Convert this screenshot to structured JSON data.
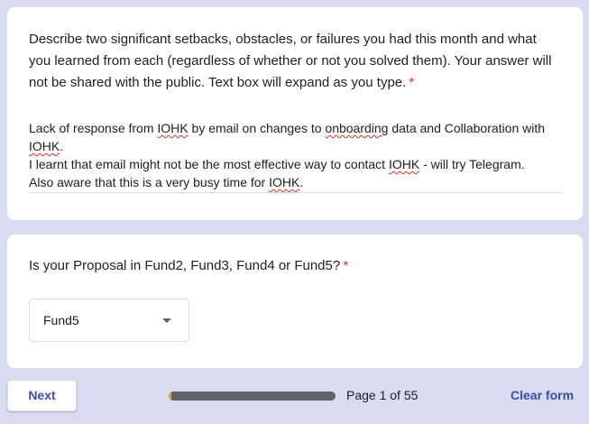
{
  "question1": {
    "title": "Describe two significant setbacks, obstacles, or failures you had this month and what you learned from each (regardless of whether or not you solved them). Your answer will not be shared with the public. Text box will expand as you type.",
    "required_marker": "*",
    "answer": {
      "line1_a": "Lack of response from ",
      "line1_b": "IOHK",
      "line1_c": " by email on changes to ",
      "line1_d": "onboarding",
      "line1_e": " data and Collaboration with ",
      "line1_f": "IOHK",
      "line1_g": ".",
      "line2_a": "I learnt that email might not be the most effective way to contact ",
      "line2_b": "IOHK",
      "line2_c": " - will try Telegram.",
      "line3_a": "Also aware that this is a very busy time for ",
      "line3_b": "IOHK",
      "line3_c": "."
    }
  },
  "question2": {
    "title": "Is your Proposal in Fund2, Fund3, Fund4 or Fund5?",
    "required_marker": "*",
    "selected_value": "Fund5"
  },
  "footer": {
    "next_label": "Next",
    "page_text": "Page 1 of 55",
    "clear_label": "Clear form",
    "progress_fraction": 0.018
  },
  "colors": {
    "background": "#d9dcf0",
    "accent": "#3c4bb0",
    "required": "#d93025",
    "progress_fill": "#f6a019",
    "progress_track": "#5f6368"
  }
}
